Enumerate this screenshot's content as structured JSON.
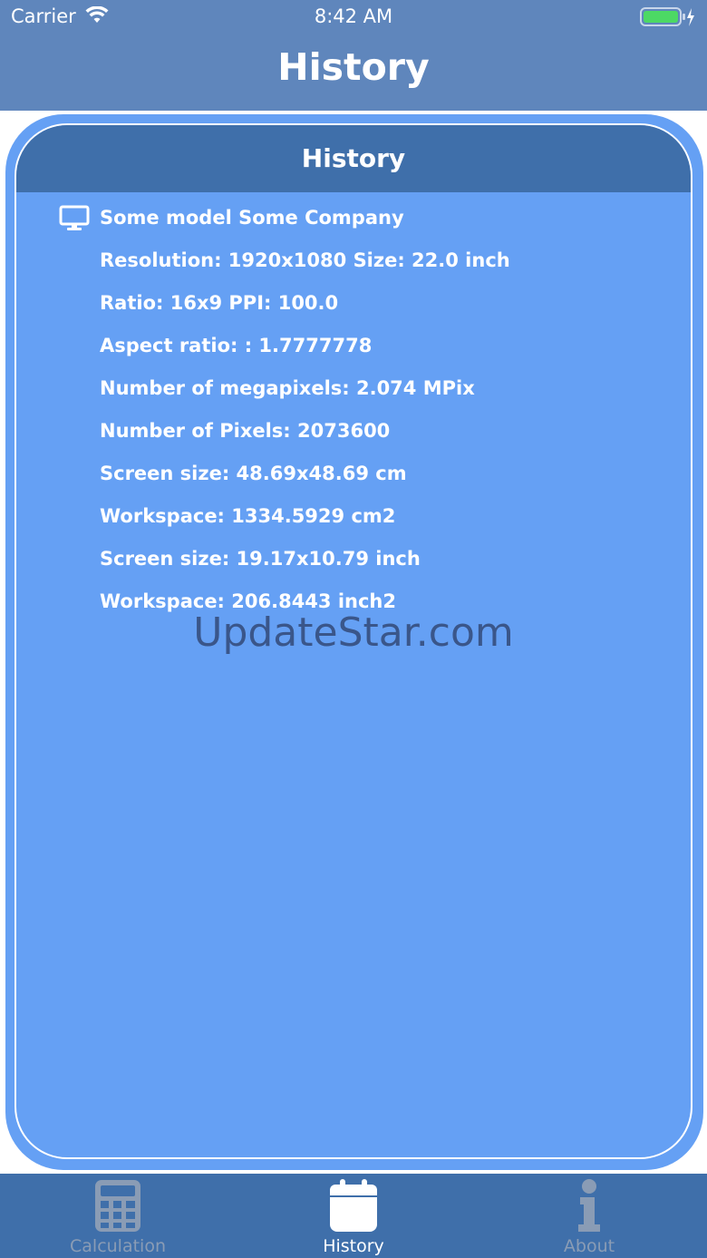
{
  "status_bar": {
    "carrier": "Carrier",
    "time": "8:42 AM"
  },
  "nav": {
    "title": "History"
  },
  "card": {
    "header": "History",
    "device": "Some model Some Company",
    "details": [
      "Resolution: 1920x1080 Size: 22.0 inch",
      "Ratio: 16x9 PPI: 100.0",
      "Aspect ratio: : 1.7777778",
      "Number of megapixels: 2.074 MPix",
      "Number of Pixels: 2073600",
      "Screen size: 48.69x48.69 cm",
      "Workspace: 1334.5929 cm2",
      "Screen size: 19.17x10.79 inch",
      "Workspace: 206.8443 inch2"
    ]
  },
  "watermark": "UpdateStar.com",
  "tabs": [
    {
      "label": "Calculation",
      "icon": "calculator-icon",
      "active": false
    },
    {
      "label": "History",
      "icon": "calendar-icon",
      "active": true
    },
    {
      "label": "About",
      "icon": "info-icon",
      "active": false
    }
  ],
  "colors": {
    "status_bar": "#5f86bc",
    "card": "#65a0f4",
    "header": "#3f6faa",
    "tab_bar": "#3f6faa"
  }
}
